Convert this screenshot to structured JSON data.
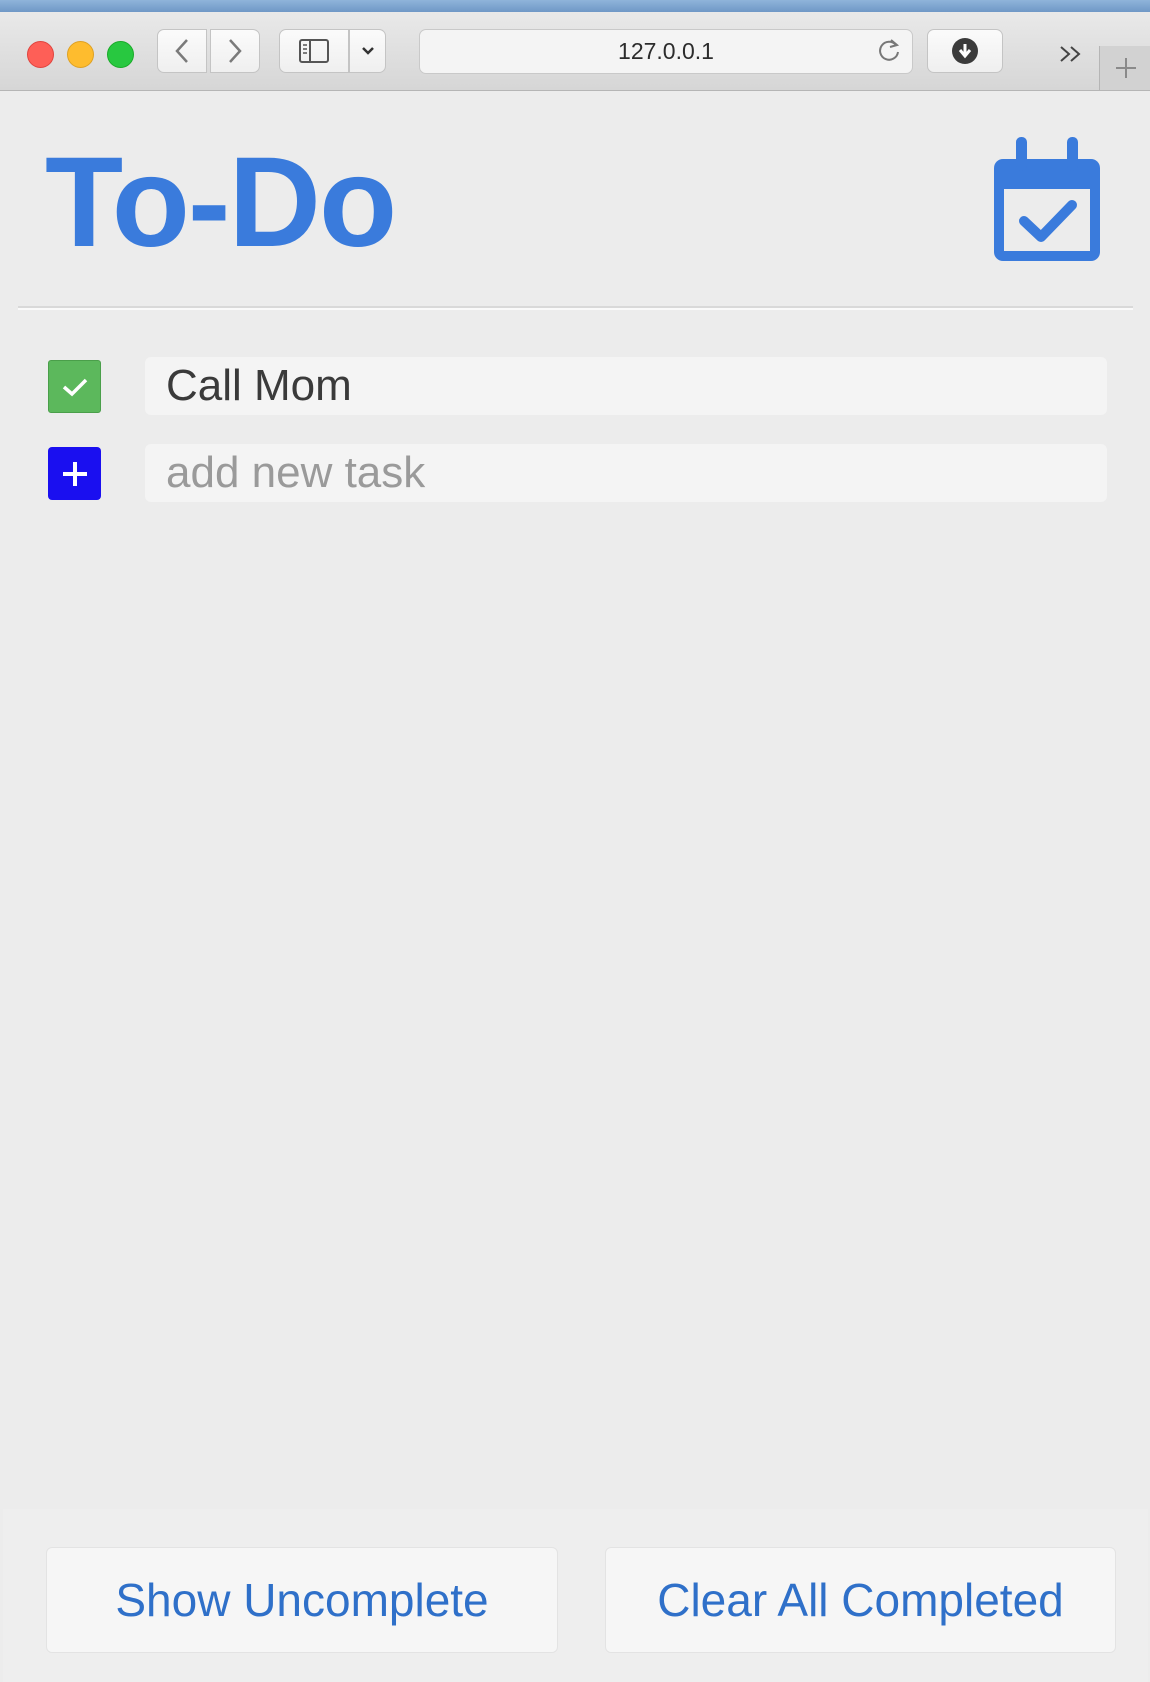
{
  "browser": {
    "url": "127.0.0.1",
    "icons": [
      "close-dot",
      "minimize-dot",
      "zoom-dot",
      "chevron-left-icon",
      "chevron-right-icon",
      "sidebar-icon",
      "chevron-down-icon",
      "reload-icon",
      "download-icon",
      "double-chevron-icon",
      "plus-icon"
    ]
  },
  "app": {
    "title": "To-Do",
    "accent_color": "#3a7bdc",
    "header_icon": "calendar-check-icon"
  },
  "tasks": [
    {
      "text": "Call Mom",
      "completed": true,
      "status_color": "#5cb85c"
    }
  ],
  "new_task": {
    "placeholder": "add new task",
    "value": "",
    "button_color": "#1a0ff0"
  },
  "footer": {
    "show_uncomplete_label": "Show Uncomplete",
    "clear_completed_label": "Clear All Completed"
  }
}
